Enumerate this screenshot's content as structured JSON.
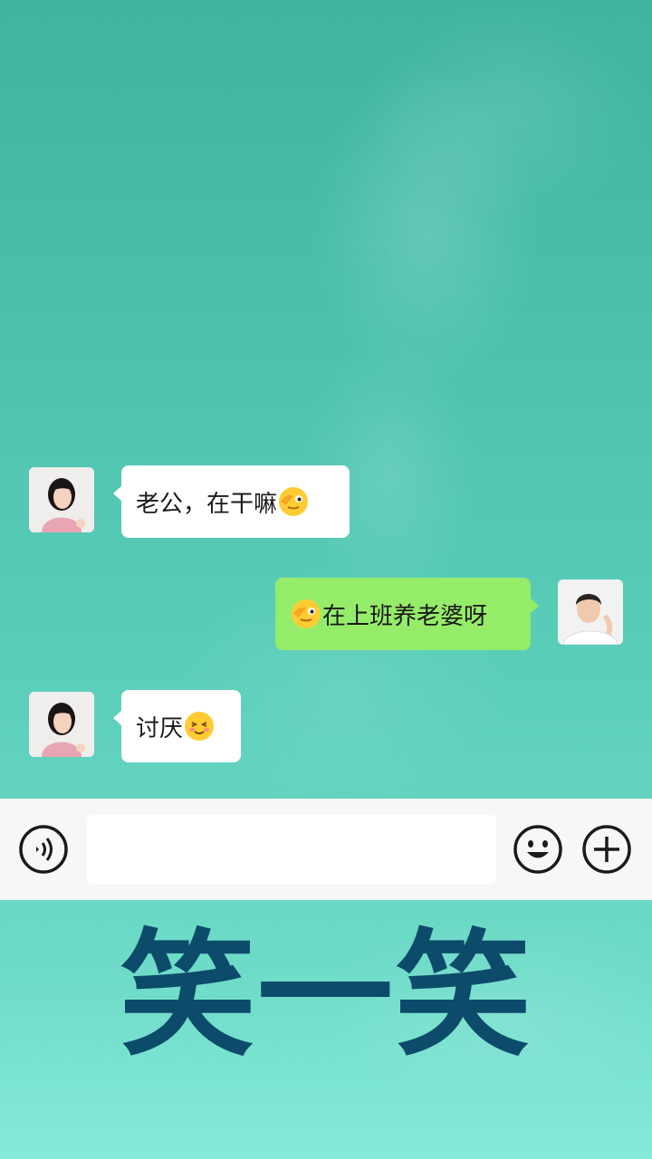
{
  "chat": {
    "messages": [
      {
        "side": "left",
        "sender": "wife",
        "text": "老公，在干嘛",
        "emoji": "face-with-hand-over-eye-emoji"
      },
      {
        "side": "right",
        "sender": "husband",
        "text": "在上班养老婆呀",
        "emoji": "face-with-hand-over-eye-emoji"
      },
      {
        "side": "left",
        "sender": "wife",
        "text": "讨厌",
        "emoji": "blushing-smile-emoji"
      }
    ]
  },
  "input_bar": {
    "value": "",
    "voice_icon": "voice-icon",
    "emoji_icon": "smiley-icon",
    "plus_icon": "plus-icon"
  },
  "caption": {
    "text": "笑一笑"
  },
  "colors": {
    "background_top": "#3fb4a0",
    "background_bottom": "#86ead9",
    "bubble_incoming": "#ffffff",
    "bubble_outgoing": "#95ec69",
    "input_bar": "#f7f7f7",
    "caption": "#0d4b6b"
  }
}
